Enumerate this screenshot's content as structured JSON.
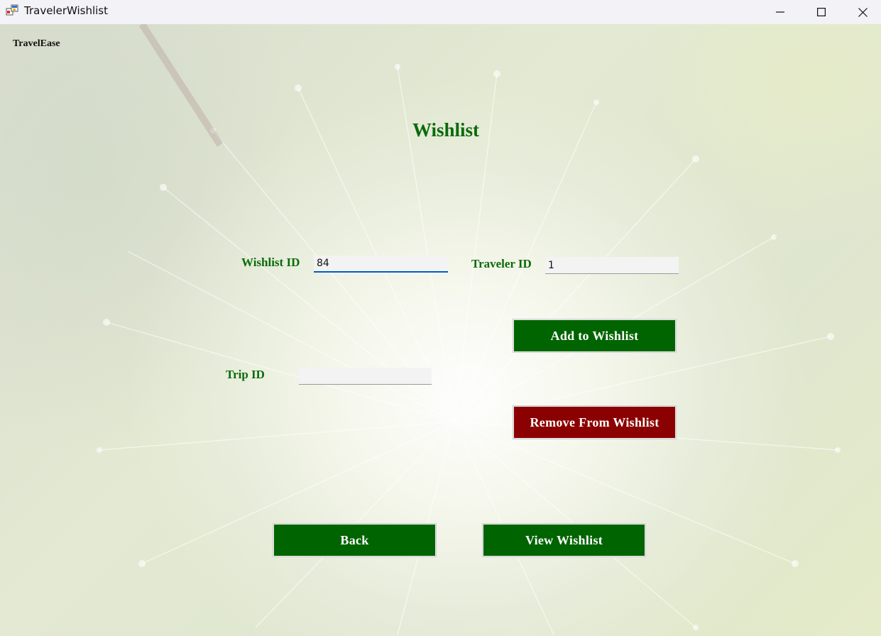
{
  "window": {
    "title": "TravelerWishlist",
    "app_icon": "winforms-app-icon",
    "controls": [
      "minimize-icon",
      "maximize-icon",
      "close-icon"
    ]
  },
  "brand": "TravelEase",
  "heading": "Wishlist",
  "form": {
    "wishlist_id": {
      "label": "Wishlist ID",
      "value": "84"
    },
    "traveler_id": {
      "label": "Traveler ID",
      "value": "1"
    },
    "trip_id": {
      "label": "Trip ID",
      "value": ""
    }
  },
  "buttons": {
    "add": "Add to Wishlist",
    "remove": "Remove From Wishlist",
    "back": "Back",
    "view": "View Wishlist"
  },
  "colors": {
    "accent_green": "#006400",
    "danger_red": "#8b0000",
    "label_green": "#0a6b0a"
  }
}
